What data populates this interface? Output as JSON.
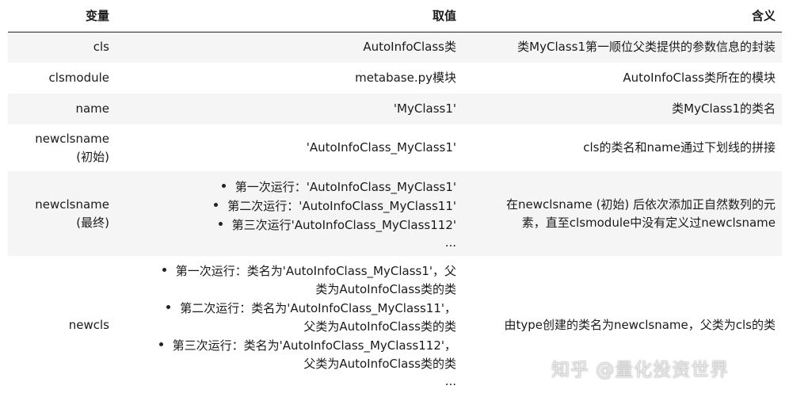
{
  "headers": [
    "变量",
    "取值",
    "含义"
  ],
  "rows": [
    {
      "var": [
        "cls"
      ],
      "value": "AutoInfoClass类",
      "meaning": [
        "类MyClass1第一顺位父类提供的参数信息的封装"
      ]
    },
    {
      "var": [
        "clsmodule"
      ],
      "value": "metabase.py模块",
      "meaning": [
        "AutoInfoClass类所在的模块"
      ]
    },
    {
      "var": [
        "name"
      ],
      "value": "'MyClass1'",
      "meaning": [
        "类MyClass1的类名"
      ]
    },
    {
      "var": [
        "newclsname",
        "(初始)"
      ],
      "value": "'AutoInfoClass_MyClass1'",
      "meaning": [
        "cls的类名和name通过下划线的拼接"
      ]
    },
    {
      "var": [
        "newclsname",
        "(最终)"
      ],
      "list": [
        "第一次运行：'AutoInfoClass_MyClass1'",
        "第二次运行：'AutoInfoClass_MyClass11'",
        "第三次运行'AutoInfoClass_MyClass112'"
      ],
      "ellipsis": "...",
      "meaning": [
        "在newclsname (初始) 后依次添加正自然数列的元",
        "素，直至clsmodule中没有定义过newclsname"
      ]
    },
    {
      "var": [
        "newcls"
      ],
      "list2": [
        [
          "第一次运行：类名为'AutoInfoClass_MyClass1'，父",
          "类为AutoInfoClass类的类"
        ],
        [
          "第二次运行：类名为'AutoInfoClass_MyClass11'，",
          "父类为AutoInfoClass类的类"
        ],
        [
          "第三次运行：类名为'AutoInfoClass_MyClass112'，",
          "父类为AutoInfoClass类的类"
        ]
      ],
      "ellipsis": "...",
      "meaning": [
        "由type创建的类名为newclsname，父类为cls的类"
      ]
    }
  ],
  "watermark": "知乎 @量化投资世界"
}
